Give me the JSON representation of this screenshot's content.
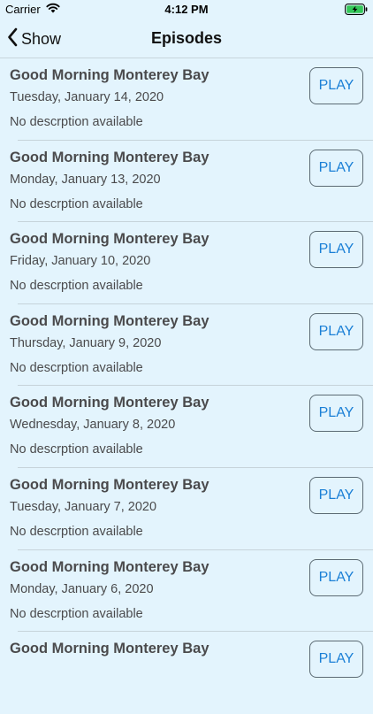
{
  "status_bar": {
    "carrier": "Carrier",
    "time": "4:12 PM",
    "wifi_icon": "wifi-icon",
    "battery_icon": "battery-charging-icon",
    "battery_color": "#34c759"
  },
  "nav": {
    "back_label": "Show",
    "title": "Episodes",
    "back_icon": "chevron-left-icon"
  },
  "colors": {
    "background": "#e3f4fd",
    "play_text": "#1a7fd6",
    "text": "#4a4a4c"
  },
  "episodes": [
    {
      "title": "Good Morning Monterey Bay",
      "date": "Tuesday, January 14, 2020",
      "description": "No descrption available",
      "play_label": "PLAY"
    },
    {
      "title": "Good Morning Monterey Bay",
      "date": "Monday, January 13, 2020",
      "description": "No descrption available",
      "play_label": "PLAY"
    },
    {
      "title": "Good Morning Monterey Bay",
      "date": "Friday, January 10, 2020",
      "description": "No descrption available",
      "play_label": "PLAY"
    },
    {
      "title": "Good Morning Monterey Bay",
      "date": "Thursday, January 9, 2020",
      "description": "No descrption available",
      "play_label": "PLAY"
    },
    {
      "title": "Good Morning Monterey Bay",
      "date": "Wednesday, January 8, 2020",
      "description": "No descrption available",
      "play_label": "PLAY"
    },
    {
      "title": "Good Morning Monterey Bay",
      "date": "Tuesday, January 7, 2020",
      "description": "No descrption available",
      "play_label": "PLAY"
    },
    {
      "title": "Good Morning Monterey Bay",
      "date": "Monday, January 6, 2020",
      "description": "No descrption available",
      "play_label": "PLAY"
    },
    {
      "title": "Good Morning Monterey Bay",
      "date": "",
      "description": "",
      "play_label": "PLAY"
    }
  ]
}
